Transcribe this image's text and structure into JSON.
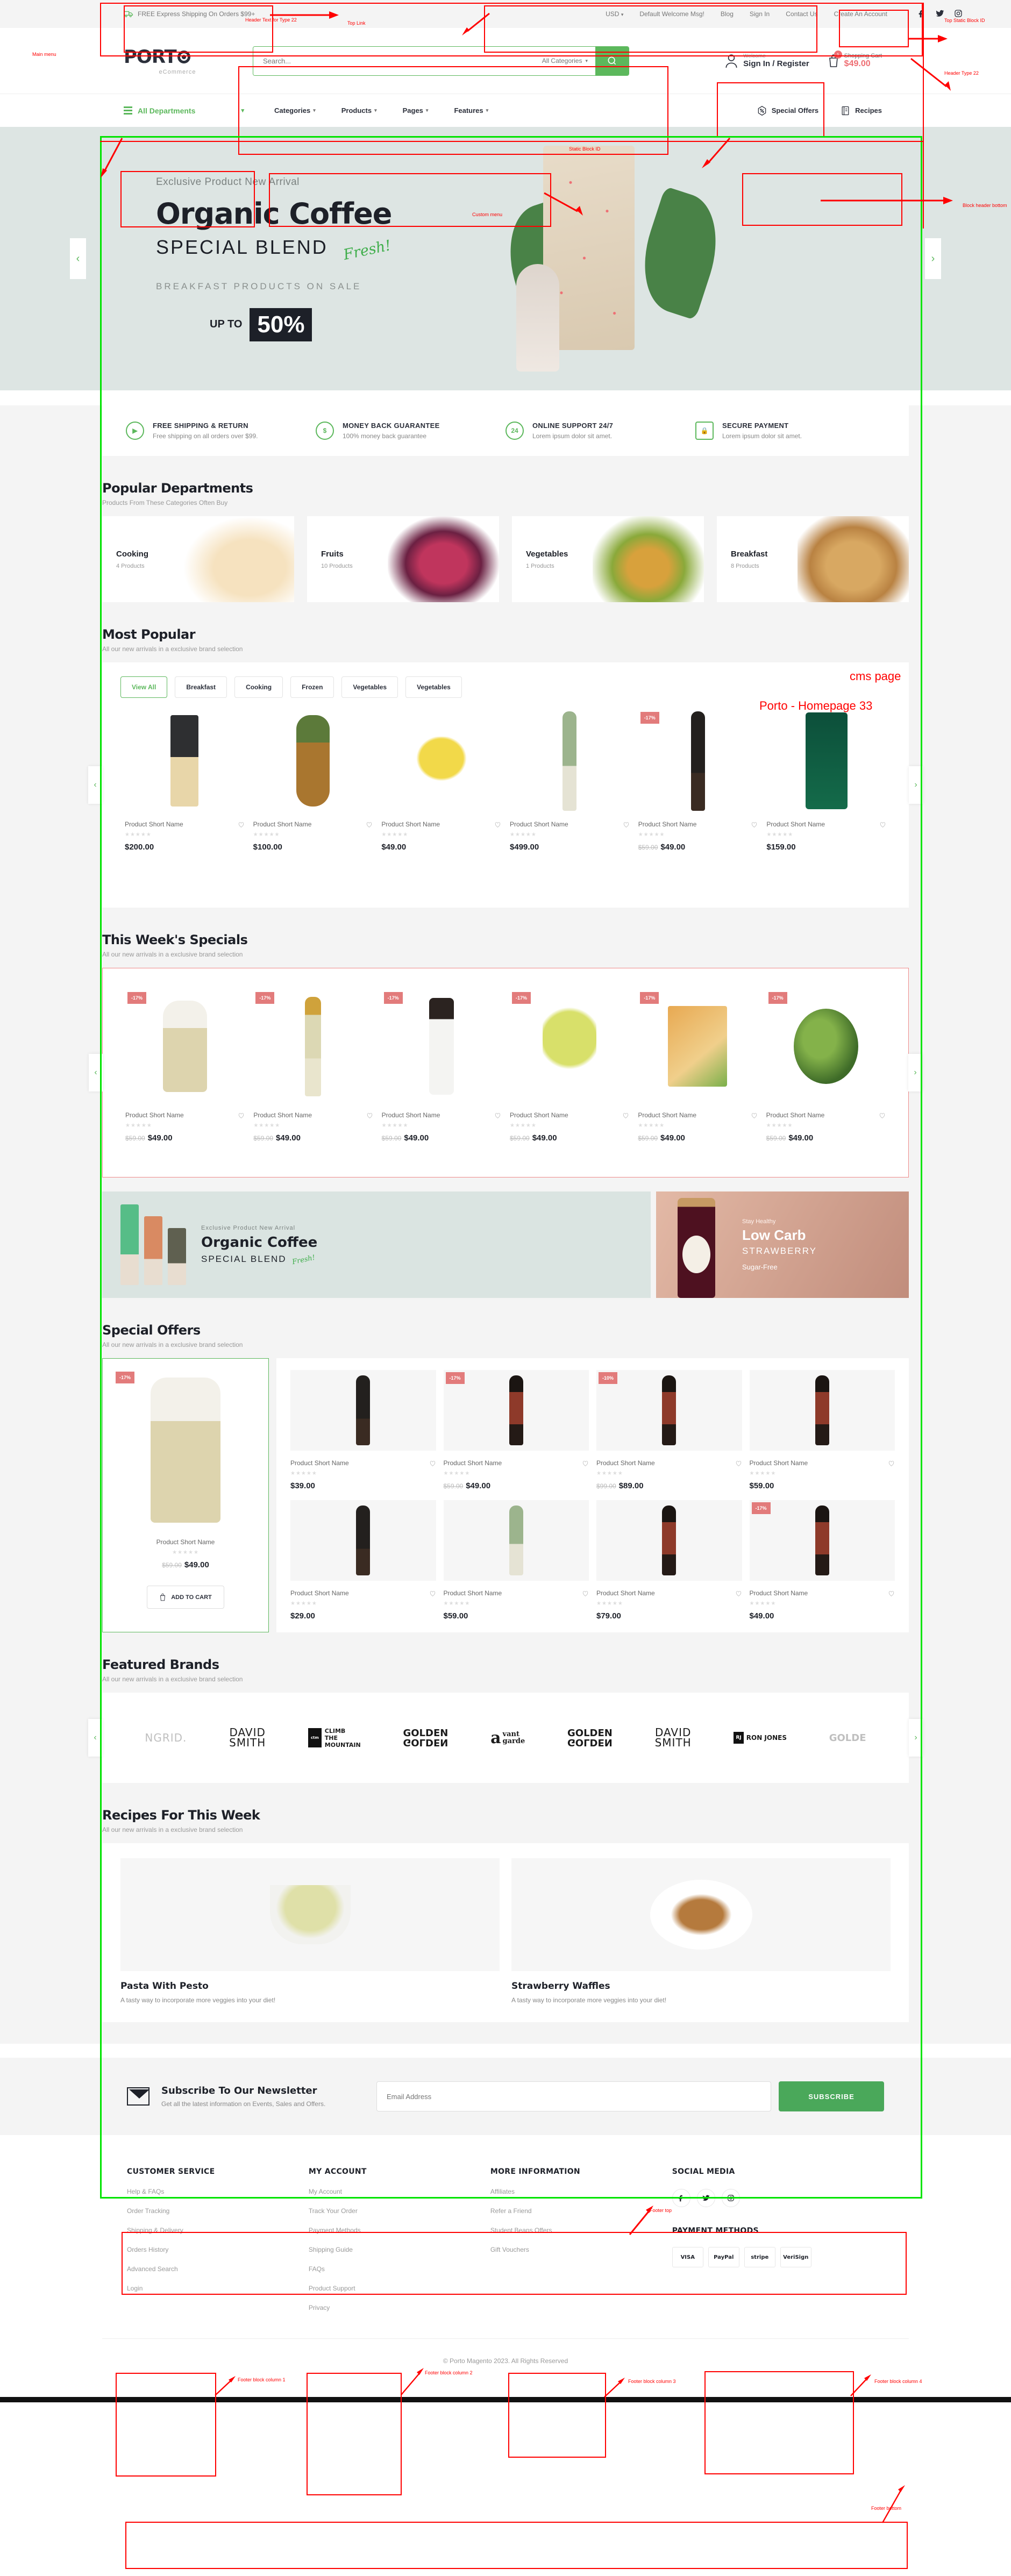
{
  "annotations": [
    {
      "label": "Header Text for Type 22"
    },
    {
      "label": "Top Link"
    },
    {
      "label": "Top Static Block ID"
    },
    {
      "label": "Header Type 22"
    },
    {
      "label": "Static Block ID"
    },
    {
      "label": "Custom menu"
    },
    {
      "label": "Block header bottom"
    },
    {
      "label": "Main menu"
    },
    {
      "label": "cms page"
    },
    {
      "label": "Porto - Homepage 33"
    },
    {
      "label": "Footer top"
    },
    {
      "label": "Footer block column 1"
    },
    {
      "label": "Footer block column 2"
    },
    {
      "label": "Footer block column 3"
    },
    {
      "label": "Footer block column 4"
    },
    {
      "label": "Footer bottom"
    }
  ],
  "topbar": {
    "promo": "FREE Express Shipping On Orders $99+",
    "currency": "USD",
    "links": [
      "Default Welcome Msg!",
      "Blog",
      "Sign In",
      "Contact Us",
      "Create An Account"
    ],
    "social": [
      "facebook-icon",
      "twitter-icon",
      "instagram-icon"
    ]
  },
  "header": {
    "logo": "PORT",
    "logo_sub": "eCommerce",
    "search_placeholder": "Search...",
    "search_category": "All Categories",
    "account_welcome": "Welcome",
    "account_label": "Sign In / Register",
    "cart_label": "Shopping Cart",
    "cart_total": "$49.00",
    "cart_count": "1"
  },
  "nav": {
    "all_departments": "All Departments",
    "menu": [
      "Categories",
      "Products",
      "Pages",
      "Features"
    ],
    "right": [
      {
        "label": "Special Offers",
        "icon": "percent-icon"
      },
      {
        "label": "Recipes",
        "icon": "book-icon"
      }
    ]
  },
  "hero": {
    "eyebrow": "Exclusive Product New Arrival",
    "title": "Organic Coffee",
    "subtitle": "SPECIAL BLEND",
    "fresh": "Fresh!",
    "breakfast": "BREAKFAST PRODUCTS ON SALE",
    "upto": "UP TO",
    "percent": "50%"
  },
  "services": [
    {
      "title": "FREE SHIPPING & RETURN",
      "desc": "Free shipping on all orders over $99.",
      "icon": "truck-icon"
    },
    {
      "title": "MONEY BACK GUARANTEE",
      "desc": "100% money back guarantee",
      "icon": "dollar-icon"
    },
    {
      "title": "ONLINE SUPPORT 24/7",
      "desc": "Lorem ipsum dolor sit amet.",
      "icon": "support-icon"
    },
    {
      "title": "SECURE PAYMENT",
      "desc": "Lorem ipsum dolor sit amet.",
      "icon": "lock-icon"
    }
  ],
  "departments": {
    "title": "Popular Departments",
    "subtitle": "Products From These Categories Often Buy",
    "items": [
      {
        "name": "Cooking",
        "count": "4 Products"
      },
      {
        "name": "Fruits",
        "count": "10 Products"
      },
      {
        "name": "Vegetables",
        "count": "1 Products"
      },
      {
        "name": "Breakfast",
        "count": "8 Products"
      }
    ]
  },
  "most_popular": {
    "title": "Most Popular",
    "subtitle": "All our new arrivals in a exclusive brand selection",
    "tabs": [
      "View All",
      "Breakfast",
      "Cooking",
      "Frozen",
      "Vegetables",
      "Vegetables"
    ],
    "active_tab": "View All",
    "products": [
      {
        "name": "Product Short Name",
        "price": "$200.00",
        "old": "",
        "badge": ""
      },
      {
        "name": "Product Short Name",
        "price": "$100.00",
        "old": "",
        "badge": ""
      },
      {
        "name": "Product Short Name",
        "price": "$49.00",
        "old": "",
        "badge": ""
      },
      {
        "name": "Product Short Name",
        "price": "$499.00",
        "old": "",
        "badge": ""
      },
      {
        "name": "Product Short Name",
        "price": "$49.00",
        "old": "$59.00",
        "badge": "-17%"
      },
      {
        "name": "Product Short Name",
        "price": "$159.00",
        "old": "",
        "badge": ""
      }
    ]
  },
  "weekly_specials": {
    "title": "This Week's Specials",
    "subtitle": "All our new arrivals in a exclusive brand selection",
    "products": [
      {
        "name": "Product Short Name",
        "price": "$49.00",
        "old": "$59.00",
        "badge": "-17%"
      },
      {
        "name": "Product Short Name",
        "price": "$49.00",
        "old": "$59.00",
        "badge": "-17%"
      },
      {
        "name": "Product Short Name",
        "price": "$49.00",
        "old": "$59.00",
        "badge": "-17%"
      },
      {
        "name": "Product Short Name",
        "price": "$49.00",
        "old": "$59.00",
        "badge": "-17%"
      },
      {
        "name": "Product Short Name",
        "price": "$49.00",
        "old": "$59.00",
        "badge": "-17%"
      },
      {
        "name": "Product Short Name",
        "price": "$49.00",
        "old": "$59.00",
        "badge": "-17%"
      }
    ]
  },
  "mid_banners": {
    "left": {
      "eyebrow": "Exclusive Product New Arrival",
      "title": "Organic Coffee",
      "subtitle": "SPECIAL BLEND",
      "fresh": "Fresh!"
    },
    "right": {
      "eyebrow": "Stay Healthy",
      "title": "Low Carb",
      "subtitle": "STRAWBERRY",
      "footnote": "Sugar-Free"
    }
  },
  "special_offers": {
    "title": "Special Offers",
    "subtitle": "All our new arrivals in a exclusive brand selection",
    "feature": {
      "name": "Product Short Name",
      "price": "$49.00",
      "old": "$59.00",
      "badge": "-17%",
      "add_to_cart": "ADD TO CART"
    },
    "grid": [
      {
        "name": "Product Short Name",
        "price": "$39.00",
        "old": "",
        "badge": ""
      },
      {
        "name": "Product Short Name",
        "price": "$49.00",
        "old": "$59.00",
        "badge": "-17%"
      },
      {
        "name": "Product Short Name",
        "price": "$89.00",
        "old": "$99.00",
        "badge": "-10%"
      },
      {
        "name": "Product Short Name",
        "price": "$59.00",
        "old": "",
        "badge": ""
      },
      {
        "name": "Product Short Name",
        "price": "$29.00",
        "old": "",
        "badge": ""
      },
      {
        "name": "Product Short Name",
        "price": "$59.00",
        "old": "",
        "badge": ""
      },
      {
        "name": "Product Short Name",
        "price": "$79.00",
        "old": "",
        "badge": ""
      },
      {
        "name": "Product Short Name",
        "price": "$49.00",
        "old": "",
        "badge": "-17%"
      }
    ]
  },
  "brands": {
    "title": "Featured Brands",
    "subtitle": "All our new arrivals in a exclusive brand selection",
    "items": [
      "NGRID.",
      "DAVID SMITH",
      "CLIMB THE MOUNTAIN",
      "GOLDEN",
      "avant garde",
      "GOLDEN",
      "DAVID SMITH",
      "RON JONES",
      "GOLDEN"
    ]
  },
  "recipes": {
    "title": "Recipes For This Week",
    "subtitle": "All our new arrivals in a exclusive brand selection",
    "items": [
      {
        "title": "Pasta With Pesto",
        "desc": "A tasty way to incorporate more veggies into your diet!"
      },
      {
        "title": "Strawberry Waffles",
        "desc": "A tasty way to incorporate more veggies into your diet!"
      }
    ]
  },
  "newsletter": {
    "title": "Subscribe To Our Newsletter",
    "desc": "Get all the latest information on Events, Sales and Offers.",
    "placeholder": "Email Address",
    "button": "SUBSCRIBE"
  },
  "footer": {
    "columns": [
      {
        "heading": "CUSTOMER SERVICE",
        "links": [
          "Help & FAQs",
          "Order Tracking",
          "Shipping & Delivery",
          "Orders History",
          "Advanced Search",
          "Login"
        ]
      },
      {
        "heading": "MY ACCOUNT",
        "links": [
          "My Account",
          "Track Your Order",
          "Payment Methods",
          "Shipping Guide",
          "FAQs",
          "Product Support",
          "Privacy"
        ]
      },
      {
        "heading": "MORE INFORMATION",
        "links": [
          "Affiliates",
          "Refer a Friend",
          "Student Beans Offers",
          "Gift Vouchers"
        ]
      }
    ],
    "social_heading": "SOCIAL MEDIA",
    "social": [
      "facebook-icon",
      "twitter-icon",
      "instagram-icon"
    ],
    "payment_heading": "PAYMENT METHODS",
    "payments": [
      "VISA",
      "PayPal",
      "stripe",
      "VeriSign"
    ],
    "copyright": "© Porto Magento 2023. All Rights Reserved"
  }
}
